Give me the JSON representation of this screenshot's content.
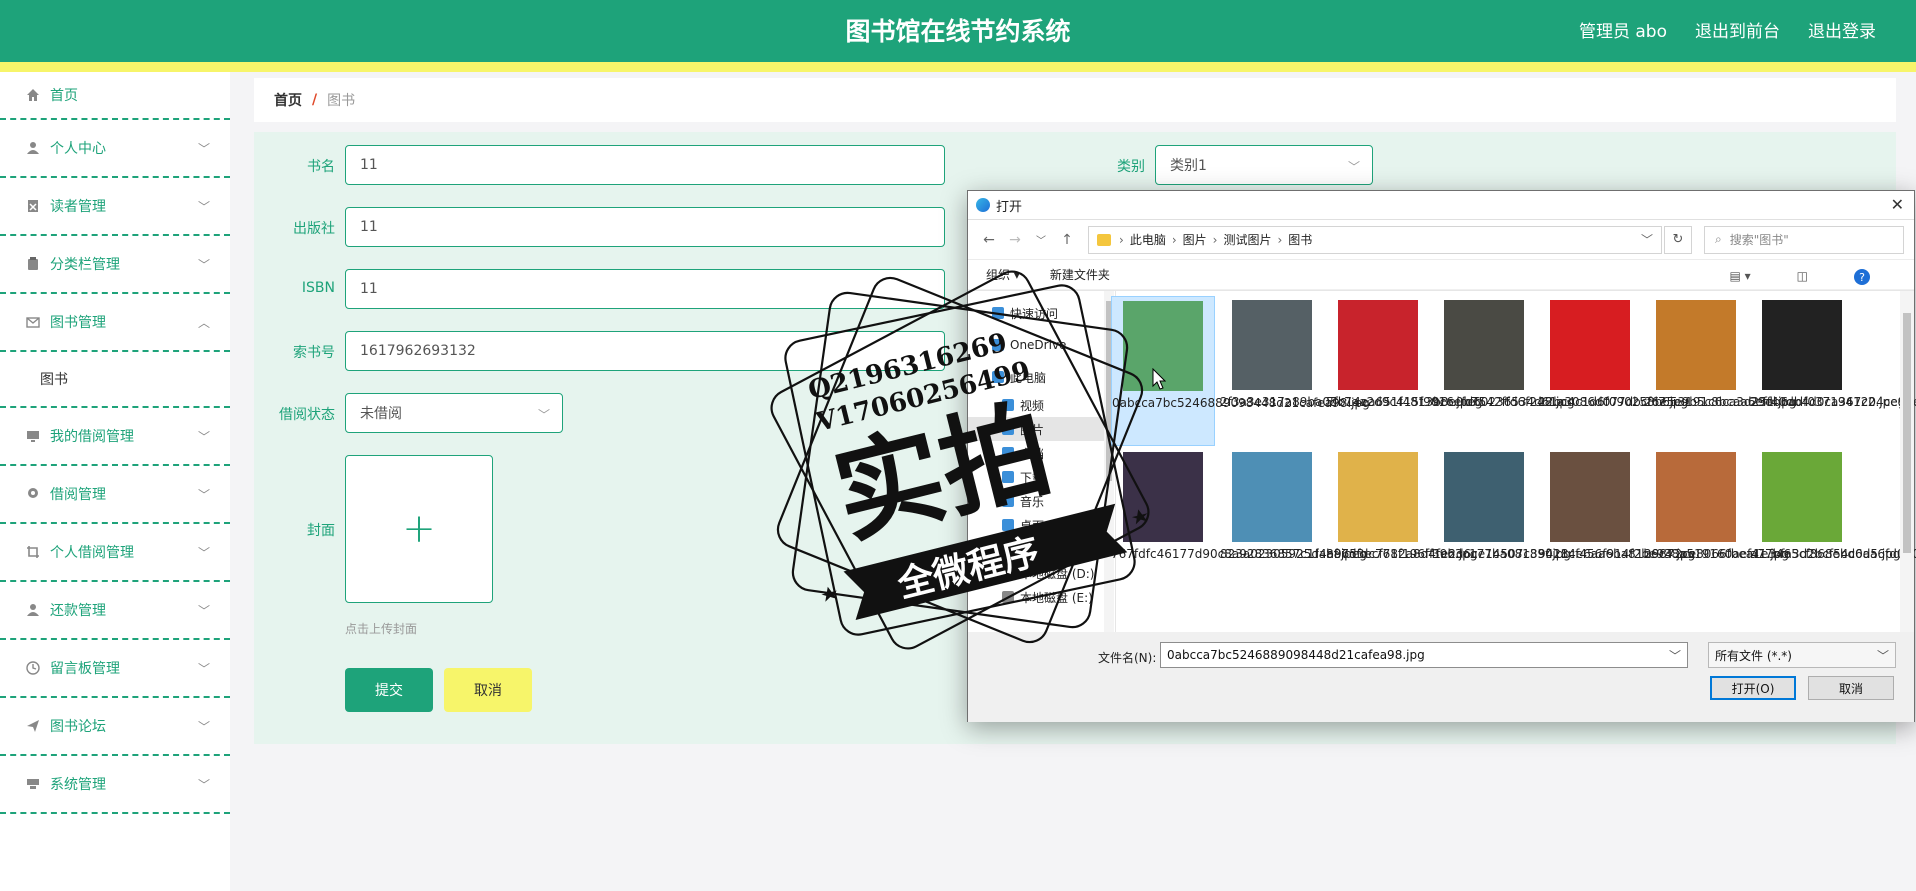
{
  "header": {
    "title": "图书馆在线节约系统",
    "admin": "管理员 abo",
    "back_front": "退出到前台",
    "logout": "退出登录"
  },
  "sidebar": {
    "items": [
      {
        "label": "首页",
        "icon": "home-icon"
      },
      {
        "label": "个人中心",
        "icon": "user-icon"
      },
      {
        "label": "读者管理",
        "icon": "reader-icon"
      },
      {
        "label": "分类栏管理",
        "icon": "clipboard-icon"
      },
      {
        "label": "图书管理",
        "icon": "mail-icon"
      },
      {
        "label": "图书",
        "icon": ""
      },
      {
        "label": "我的借阅管理",
        "icon": "monitor-icon"
      },
      {
        "label": "借阅管理",
        "icon": "pin-icon"
      },
      {
        "label": "个人借阅管理",
        "icon": "crop-icon"
      },
      {
        "label": "还款管理",
        "icon": "user-icon"
      },
      {
        "label": "留言板管理",
        "icon": "clock-icon"
      },
      {
        "label": "图书论坛",
        "icon": "send-icon"
      },
      {
        "label": "系统管理",
        "icon": "gauge-icon"
      }
    ]
  },
  "breadcrumb": {
    "home": "首页",
    "sep": "/",
    "current": "图书"
  },
  "form": {
    "book_name_label": "书名",
    "book_name": "11",
    "publisher_label": "出版社",
    "publisher": "11",
    "isbn_label": "ISBN",
    "isbn": "11",
    "call_no_label": "索书号",
    "call_no": "1617962693132",
    "status_label": "借阅状态",
    "status": "未借阅",
    "category_label": "类别",
    "category": "类别1",
    "cover_label": "封面",
    "upload_hint": "点击上传封面",
    "submit": "提交",
    "cancel": "取消"
  },
  "dialog": {
    "title": "打开",
    "path": [
      "此电脑",
      "图片",
      "测试图片",
      "图书"
    ],
    "search_placeholder": "搜索\"图书\"",
    "organize": "组织 ▾",
    "new_folder": "新建文件夹",
    "tree": [
      "快速访问",
      "OneDrive",
      "此电脑",
      "视频",
      "图片",
      "文档",
      "下载",
      "音乐",
      "桌面",
      "本地磁盘 (C:)",
      "本地磁盘 (D:)",
      "本地磁盘 (E:)"
    ],
    "files": [
      {
        "name": "0abcca7bc5246889098448d21cafea98.jpg",
        "color": "#5aa56a"
      },
      {
        "name": "2f3a3e317a89ba05c7aa2d9c415f901c.jpeg",
        "color": "#556065"
      },
      {
        "name": "5fb14ea651f4813b8e0b7542ffd6f248.jpg",
        "color": "#c8232c"
      },
      {
        "name": "9c6efd60236534d61a3086d077dbcfc7.jpg",
        "color": "#4a4a44"
      },
      {
        "name": "22bc4c1d6f090258b653191c6ca3d25e.jpg",
        "color": "#d71d21"
      },
      {
        "name": "26e5e9b5c8bcaa6eff40db4d0ca367c2.jpeg",
        "color": "#c37a2a"
      },
      {
        "name": "29db6adf0371941204ce9dec908acbaf.jpg",
        "color": "#222222"
      },
      {
        "name": "767fdfc46177d90c8a92836857c1fabf.jpeg",
        "color": "#3b3148"
      },
      {
        "name": "823a02305925d4a9653ecf682a8d4feb.jpg",
        "color": "#4e8fb5"
      },
      {
        "name": "887dfdc771f196ff1e2d6ce14507c33f.jpg",
        "color": "#e0b24a"
      },
      {
        "name": "3963c177ba081890114e6aa6ba81b6c4.jpg",
        "color": "#3e6070"
      },
      {
        "name": "9428cf456f914f2be938a519160aef41.jpg",
        "color": "#6a5040"
      },
      {
        "name": "29872ce8066fbea1e3465cf868ebd0d5.jpg",
        "color": "#b86a3a"
      },
      {
        "name": "a77bfa3d2bcf54c6aa6fd060475f8ba0.jpg",
        "color": "#6aa838"
      }
    ],
    "filename_label": "文件名(N):",
    "filename": "0abcca7bc5246889098448d21cafea98.jpg",
    "filetype": "所有文件 (*.*)",
    "open": "打开(O)",
    "cancel": "取消"
  },
  "watermark": {
    "line1": "Q2196316269",
    "line2": "V17060256499",
    "big": "实拍",
    "ribbon": "全微程序"
  }
}
